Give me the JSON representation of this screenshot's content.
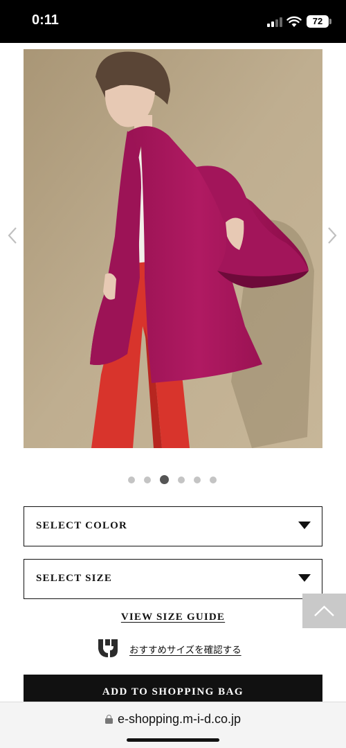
{
  "status_bar": {
    "time": "0:11",
    "battery": "72",
    "icons": [
      "signal-icon",
      "wifi-icon",
      "battery-icon"
    ]
  },
  "product": {
    "image_alt": "",
    "carousel": {
      "total_images": 6,
      "active_index": 3
    }
  },
  "options": {
    "color_select_label": "SELECT COLOR",
    "size_select_label": "SELECT SIZE"
  },
  "size_guide_link": "VIEW SIZE GUIDE",
  "recommend_size_link": "おすすめサイズを確認する",
  "add_to_bag_label": "ADD TO SHOPPING BAG",
  "browser": {
    "url": "e-shopping.m-i-d.co.jp"
  },
  "colors": {
    "coat_magenta": "#a8165c",
    "pants_red": "#d8342c",
    "backdrop": "#b7a588",
    "button_black": "#111111",
    "back_to_top_gray": "#c9c9c9"
  }
}
